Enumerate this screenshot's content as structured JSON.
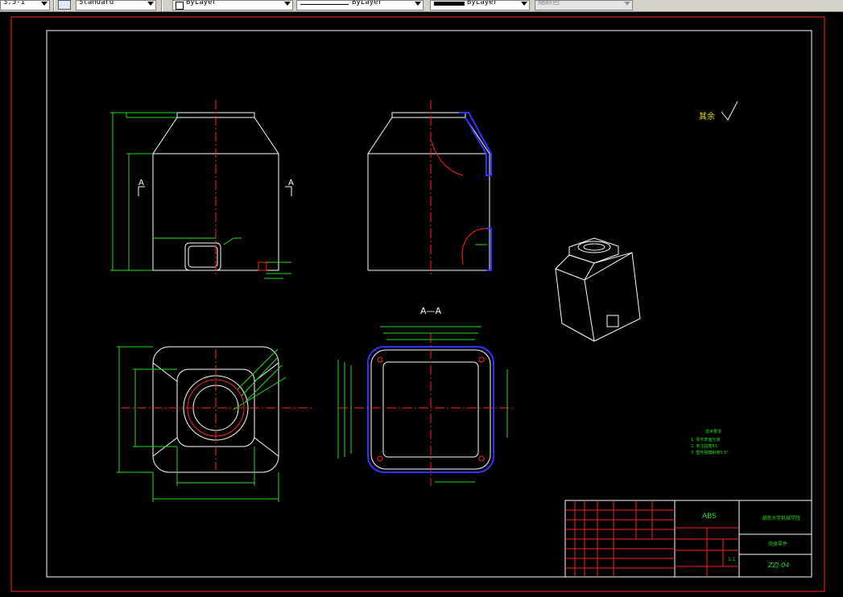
{
  "toolbar": {
    "scale": "3.5-1",
    "text_style": "Standard",
    "layer": "ByLayer",
    "linetype": "ByLayer",
    "lineweight": "ByLayer",
    "plot_color": "随颜色"
  },
  "drawing": {
    "section_label": "A—A",
    "cut_marker_left": "A",
    "cut_marker_right": "A",
    "roughness_note": "其余",
    "title_block": {
      "material": "ABS",
      "school": "湖南大学机械学院",
      "part_name": "壳体零件",
      "drawing_number": "ZZJ-04",
      "scale": "1:1"
    },
    "tech_notes": [
      "技术要求",
      "1. 零件表面光滑",
      "2. 未注圆角R1",
      "3. 塑件脱模斜度0.5°"
    ]
  },
  "colors": {
    "outline": "#ffffff",
    "dimension": "#22dd22",
    "centerline": "#ff2222",
    "frame": "#ff2222",
    "accent": "#3333ff",
    "note": "#e6e600"
  }
}
